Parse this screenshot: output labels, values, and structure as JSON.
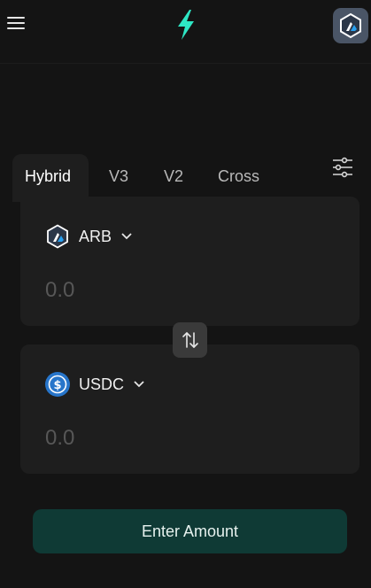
{
  "header": {
    "menu_icon": "hamburger-menu-icon",
    "logo_icon": "lightning-bolt-logo",
    "network_icon": "arbitrum-network-icon"
  },
  "tabs": [
    {
      "label": "Hybrid",
      "active": true
    },
    {
      "label": "V3",
      "active": false
    },
    {
      "label": "V2",
      "active": false
    },
    {
      "label": "Cross",
      "active": false
    }
  ],
  "settings_icon": "sliders-settings-icon",
  "from": {
    "token_symbol": "ARB",
    "token_icon": "arbitrum-token-icon",
    "amount_placeholder": "0.0"
  },
  "swap_icon": "swap-arrows-icon",
  "to": {
    "token_symbol": "USDC",
    "token_icon": "usdc-token-icon",
    "amount_placeholder": "0.0"
  },
  "cta_label": "Enter Amount",
  "colors": {
    "background": "#141414",
    "card": "#1e1e1e",
    "accent": "#2ee6c4",
    "cta_bg": "#0f3a35",
    "usdc_blue": "#2775ca"
  }
}
